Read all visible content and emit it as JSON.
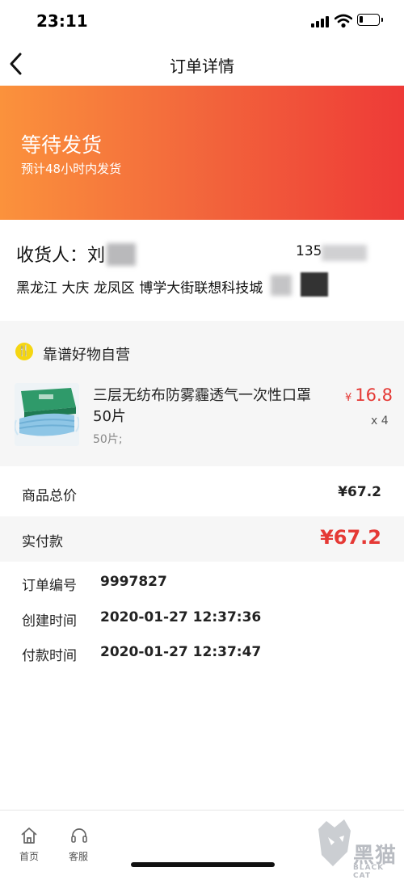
{
  "status_bar": {
    "time": "23:11"
  },
  "nav": {
    "title": "订单详情"
  },
  "order_status": {
    "title": "等待发货",
    "subtitle": "预计48小时内发货"
  },
  "recipient": {
    "name": "收货人：刘",
    "phone": "135",
    "address": "黑龙江 大庆 龙凤区  博学大街联想科技城"
  },
  "store": {
    "name": "靠谱好物自营",
    "badge_glyph": "🍴"
  },
  "product": {
    "name": "三层无纺布防雾霾透气一次性口罩50片",
    "spec": "50片;",
    "currency": "¥",
    "price": "16.8",
    "quantity": "x 4"
  },
  "summary": {
    "total_label": "商品总价",
    "total_value": "¥67.2",
    "paid_label": "实付款",
    "paid_value": "¥67.2"
  },
  "order_info": [
    {
      "label": "订单编号",
      "value": "9997827"
    },
    {
      "label": "创建时间",
      "value": "2020-01-27 12:37:36"
    },
    {
      "label": "付款时间",
      "value": "2020-01-27 12:37:47"
    }
  ],
  "tabbar": {
    "home_label": "首页",
    "service_label": "客服"
  },
  "watermark": {
    "text": "黑猫",
    "sub": "BLACK CAT"
  },
  "colors": {
    "accent_red": "#e53935",
    "banner_start": "#fb923c",
    "banner_end": "#ee3a37",
    "store_badge": "#f5d612"
  }
}
